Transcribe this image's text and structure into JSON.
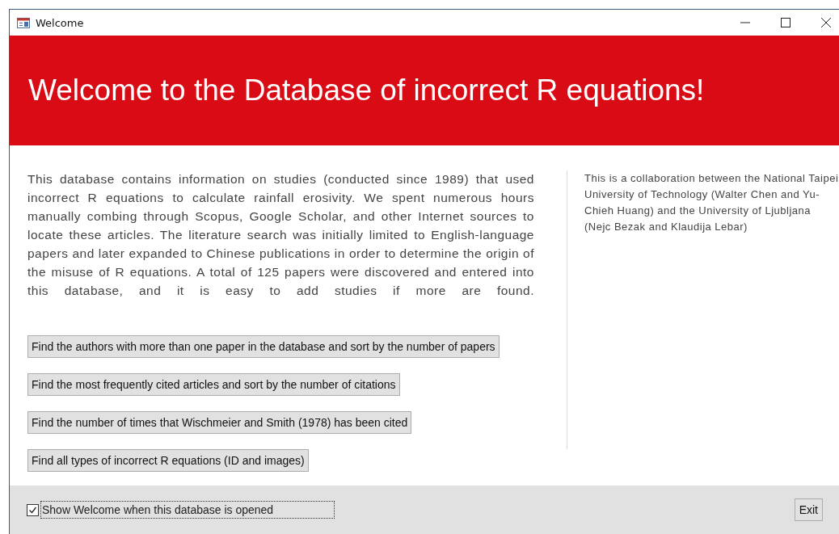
{
  "window": {
    "title": "Welcome"
  },
  "header": {
    "title": "Welcome to the Database of incorrect R equations!"
  },
  "description": "This database contains information on studies (conducted since 1989) that used incorrect R equations to calculate rainfall erosivity. We spent numerous hours manually combing through Scopus, Google Scholar, and other Internet sources to locate these articles. The literature search was initially limited to English-language papers and later expanded to Chinese publications in order to determine the origin of the misuse of R equations. A total of 125 papers were discovered and entered into this database, and it is easy to add studies if more are found.",
  "credits": "This is a collaboration between the National Taipei University of Technology (Walter Chen and Yu-Chieh Huang) and the University of Ljubljana (Nejc Bezak and Klaudija Lebar)",
  "buttons": [
    "Find the authors with more than one paper in the database and sort by the number of papers",
    "Find the most frequently cited articles and sort by the number of citations",
    "Find the number of times that Wischmeier and Smith (1978) has been cited",
    "Find all types of incorrect R equations (ID and images)"
  ],
  "footer": {
    "checkbox": {
      "label": "Show Welcome when this database is opened",
      "checked": true
    },
    "exit": "Exit"
  }
}
